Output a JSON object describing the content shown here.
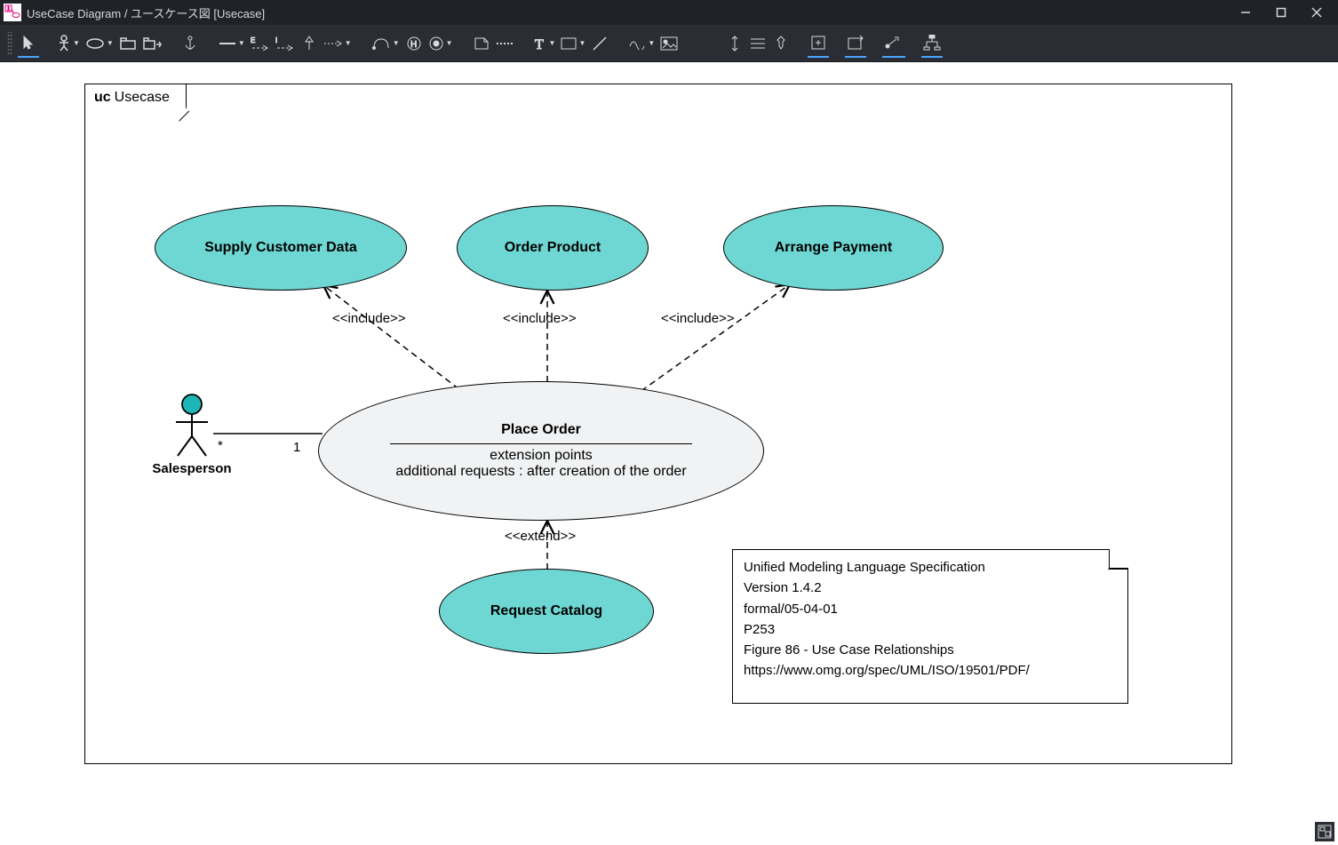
{
  "window": {
    "title": "UseCase Diagram / ユースケース図 [Usecase]",
    "min": "—",
    "max": "☐",
    "close": "✕"
  },
  "frame": {
    "kind": "uc",
    "name": "Usecase"
  },
  "actors": {
    "salesperson": {
      "name": "Salesperson"
    }
  },
  "usecases": {
    "supply": {
      "name": "Supply Customer Data"
    },
    "order": {
      "name": "Order Product"
    },
    "arrange": {
      "name": "Arrange Payment"
    },
    "request": {
      "name": "Request Catalog"
    },
    "place": {
      "name": "Place Order",
      "ext_title": "extension points",
      "ext_line": "additional requests : after creation of the order"
    }
  },
  "relations": {
    "inc1": {
      "label": "<<include>>"
    },
    "inc2": {
      "label": "<<include>>"
    },
    "inc3": {
      "label": "<<include>>"
    },
    "ext1": {
      "label": "<<extend>>"
    }
  },
  "assoc": {
    "actor_side": "*",
    "uc_side": "1"
  },
  "note": {
    "l1": "Unified Modeling Language Specification",
    "l2": "Version 1.4.2",
    "l3": "formal/05-04-01",
    "l4": "P253",
    "l5": "Figure 86 - Use Case Relationships",
    "l6": "https://www.omg.org/spec/UML/ISO/19501/PDF/"
  },
  "colors": {
    "usecase_fill": "#6fd7d3",
    "big_fill": "#f1f2f3",
    "actor_head": "#1db5b5"
  }
}
